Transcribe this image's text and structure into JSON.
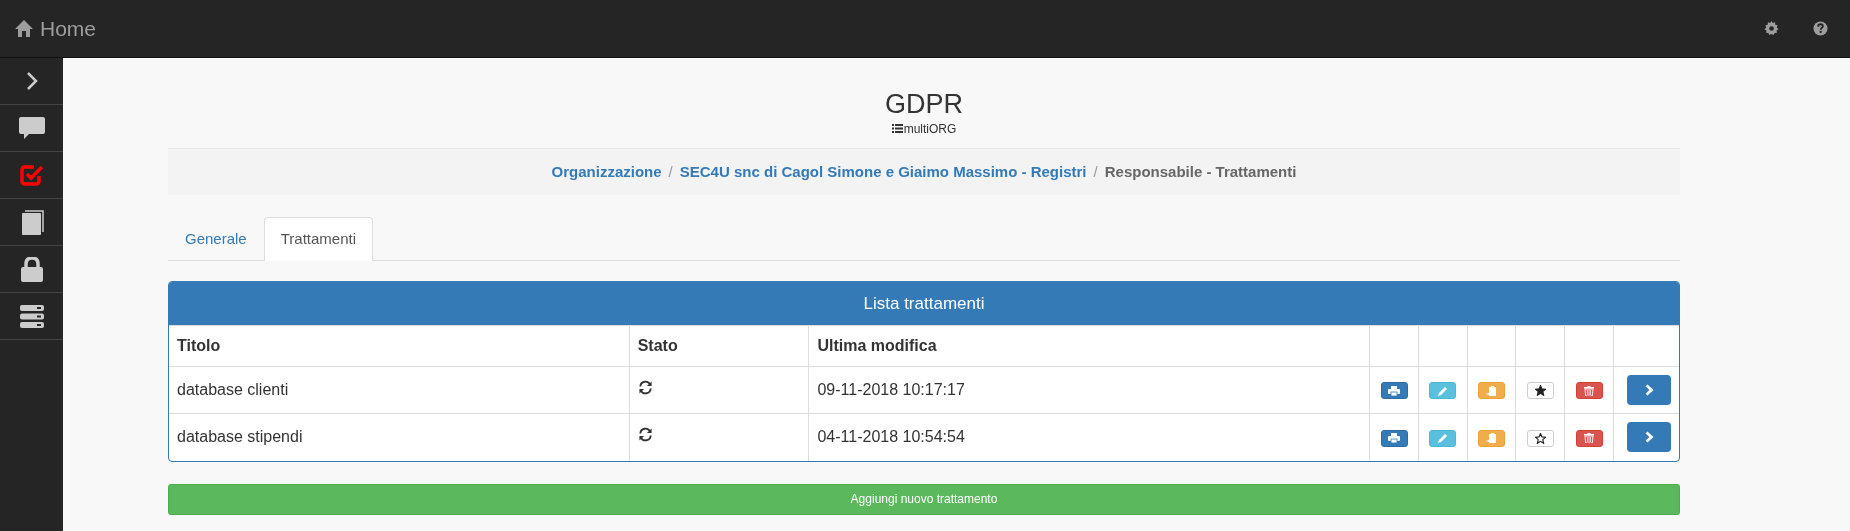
{
  "navbar": {
    "brand": "Home"
  },
  "sidebar": {
    "items": [
      {
        "selected": false
      },
      {
        "selected": false
      },
      {
        "selected": true
      },
      {
        "selected": false
      },
      {
        "selected": false
      },
      {
        "selected": false
      }
    ]
  },
  "header": {
    "title": "GDPR",
    "subtitle": "multiORG"
  },
  "breadcrumb": [
    {
      "label": "Organizzazione",
      "link": true
    },
    {
      "separator": "/",
      "label": "SEC4U snc di Cagol Simone e Giaimo Massimo - Registri",
      "link": true
    },
    {
      "separator": "/",
      "label": "Responsabile - Trattamenti",
      "link": false
    }
  ],
  "tabs": [
    {
      "label": "Generale",
      "selected": false
    },
    {
      "label": "Trattamenti",
      "selected": true
    }
  ],
  "panel": {
    "title": "Lista trattamenti"
  },
  "table": {
    "columns": [
      "Titolo",
      "Stato",
      "Ultima modifica"
    ],
    "rows": [
      {
        "title": "database clienti",
        "modified": "09-11-2018 10:17:17",
        "starred": true
      },
      {
        "title": "database stipendi",
        "modified": "04-11-2018 10:54:54",
        "starred": false
      }
    ]
  },
  "add_button": "Aggiungi nuovo trattamento"
}
